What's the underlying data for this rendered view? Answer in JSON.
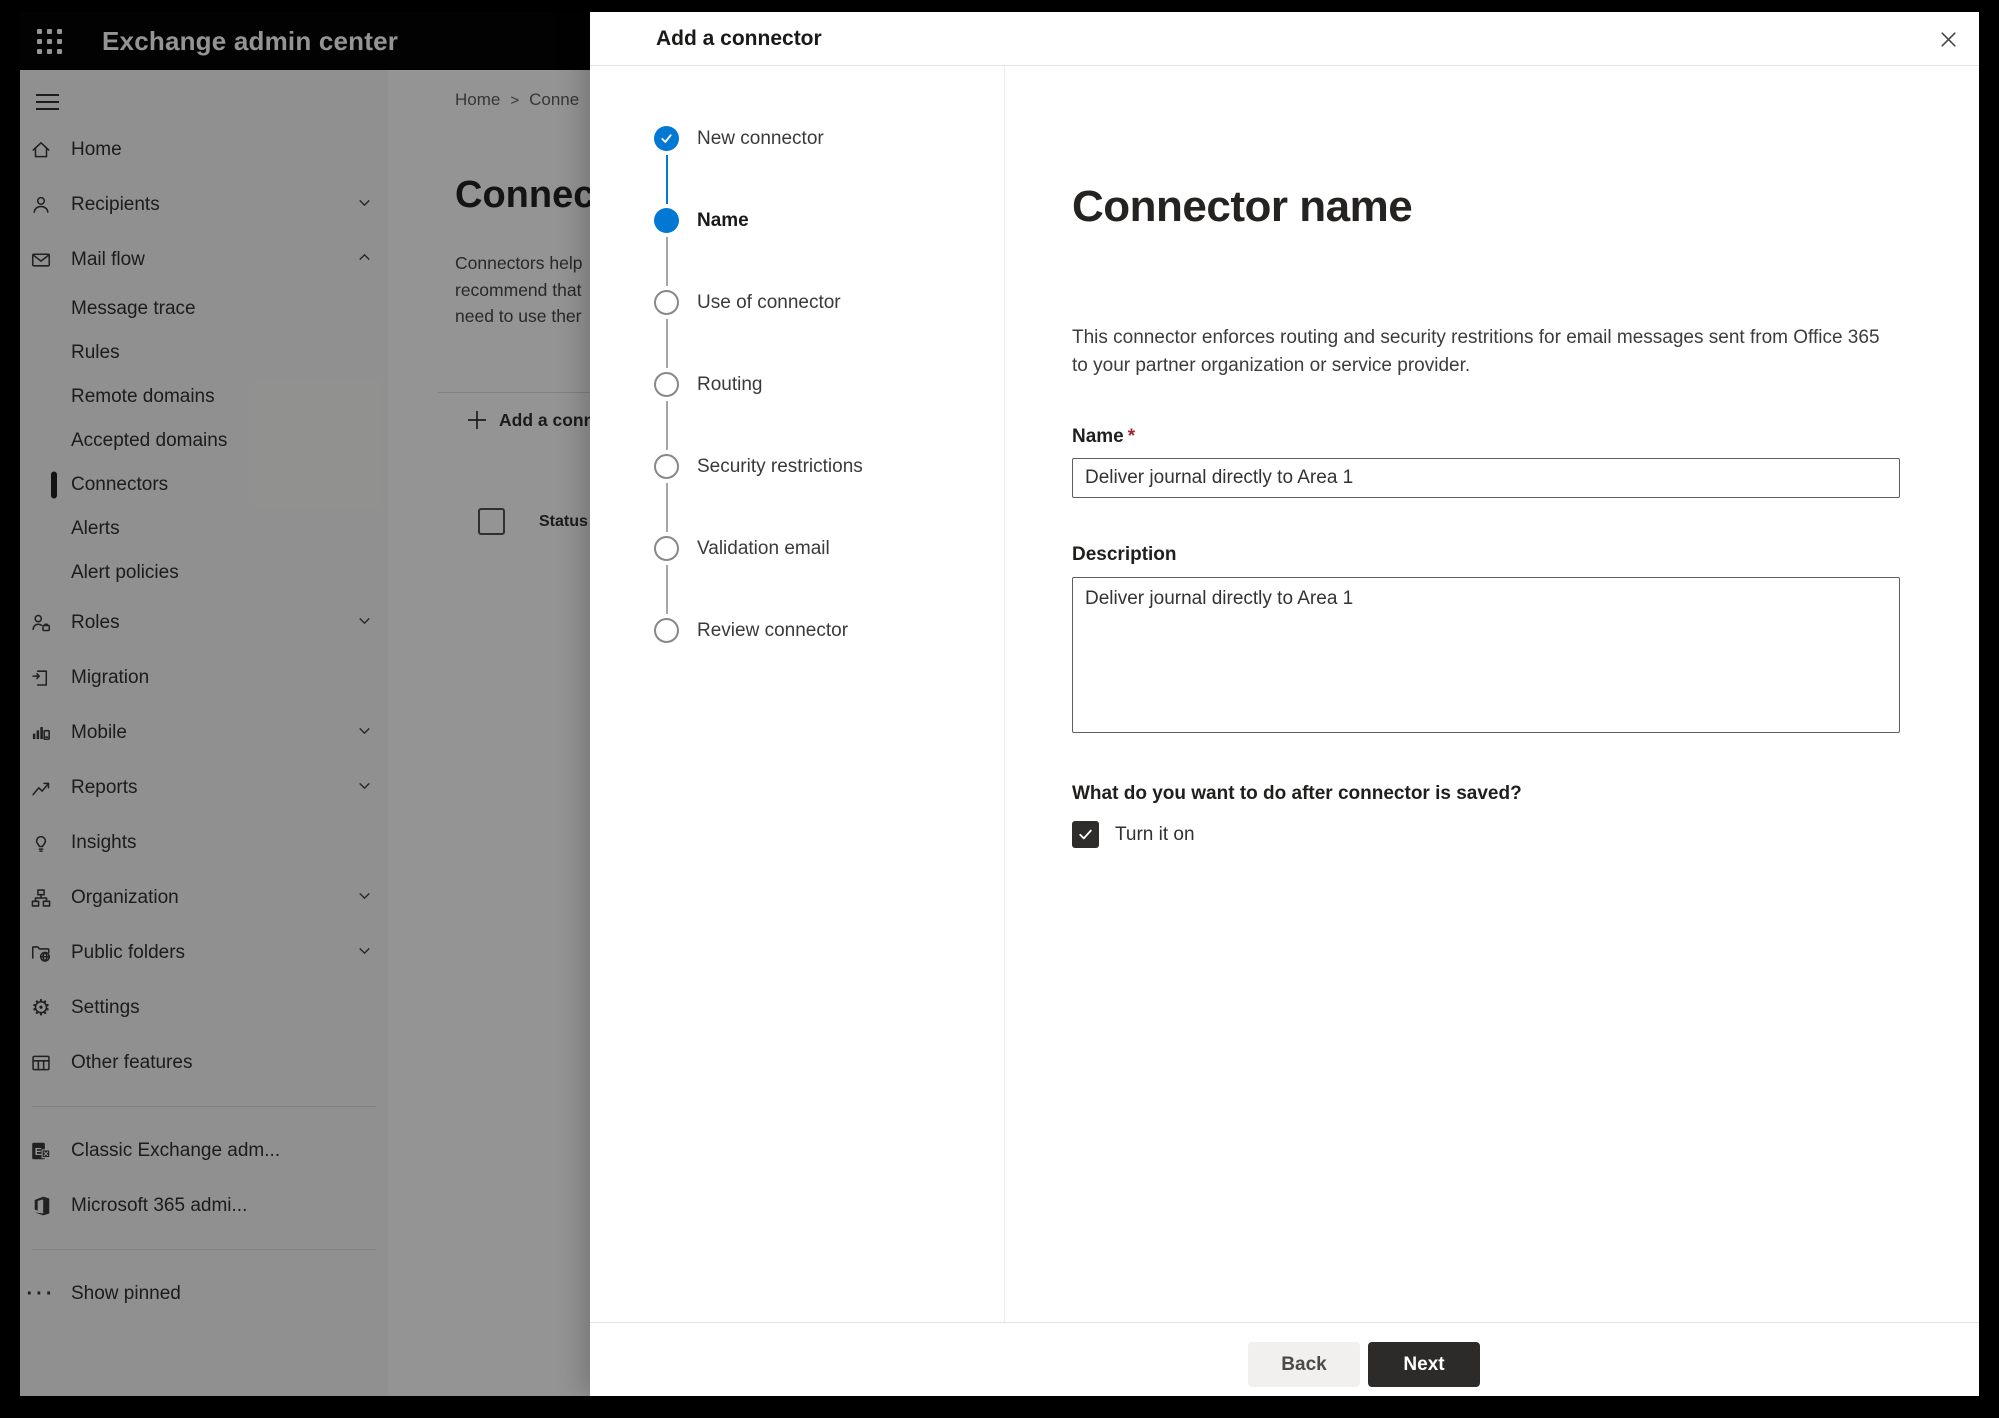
{
  "app": {
    "title": "Exchange admin center"
  },
  "sidebar": {
    "items": [
      {
        "label": "Home",
        "icon": "home-icon"
      },
      {
        "label": "Recipients",
        "icon": "person-icon",
        "chevron": "down"
      },
      {
        "label": "Mail flow",
        "icon": "mail-icon",
        "chevron": "up"
      },
      {
        "label": "Message trace",
        "sub": true
      },
      {
        "label": "Rules",
        "sub": true
      },
      {
        "label": "Remote domains",
        "sub": true
      },
      {
        "label": "Accepted domains",
        "sub": true
      },
      {
        "label": "Connectors",
        "sub": true,
        "selected": true
      },
      {
        "label": "Alerts",
        "sub": true
      },
      {
        "label": "Alert policies",
        "sub": true
      },
      {
        "label": "Roles",
        "icon": "roles-icon",
        "chevron": "down"
      },
      {
        "label": "Migration",
        "icon": "migration-icon"
      },
      {
        "label": "Mobile",
        "icon": "mobile-icon",
        "chevron": "down"
      },
      {
        "label": "Reports",
        "icon": "reports-icon",
        "chevron": "down"
      },
      {
        "label": "Insights",
        "icon": "insights-icon"
      },
      {
        "label": "Organization",
        "icon": "organization-icon",
        "chevron": "down"
      },
      {
        "label": "Public folders",
        "icon": "public-folders-icon",
        "chevron": "down"
      },
      {
        "label": "Settings",
        "icon": "settings-icon"
      },
      {
        "label": "Other features",
        "icon": "other-features-icon"
      },
      {
        "divider": true
      },
      {
        "label": "Classic Exchange adm...",
        "icon": "classic-exchange-icon"
      },
      {
        "label": "Microsoft 365 admi...",
        "icon": "microsoft-365-icon"
      },
      {
        "divider": true
      },
      {
        "label": "Show pinned",
        "icon": "ellipsis-icon"
      }
    ]
  },
  "background": {
    "breadcrumb": {
      "home": "Home",
      "separator": ">",
      "current": "Conne"
    },
    "page_title": "Connec",
    "description_lines": "Connectors help\nrecommend that\nneed to use ther",
    "add_button_label": "Add a conn",
    "table": {
      "status_header": "Status"
    }
  },
  "panel": {
    "title": "Add a connector",
    "steps": [
      {
        "label": "New connector",
        "state": "completed",
        "line": "accent"
      },
      {
        "label": "Name",
        "state": "current",
        "line": "gray"
      },
      {
        "label": "Use of connector",
        "state": "upcoming",
        "line": "gray"
      },
      {
        "label": "Routing",
        "state": "upcoming",
        "line": "gray"
      },
      {
        "label": "Security restrictions",
        "state": "upcoming",
        "line": "gray"
      },
      {
        "label": "Validation email",
        "state": "upcoming",
        "line": "gray"
      },
      {
        "label": "Review connector",
        "state": "upcoming",
        "line": "none"
      }
    ],
    "content": {
      "title": "Connector name",
      "description": "This connector enforces routing and security restritions for email messages sent from Office 365 to your partner organization or service provider.",
      "name_label": "Name",
      "required_marker": "*",
      "name_value": "Deliver journal directly to Area 1",
      "description_label": "Description",
      "description_value": "Deliver journal directly to Area 1",
      "after_save_question": "What do you want to do after connector is saved?",
      "turn_on_label": "Turn it on",
      "turn_on_checked": true
    },
    "footer": {
      "back_label": "Back",
      "next_label": "Next"
    }
  },
  "colors": {
    "accent_blue": "#0078d4",
    "header_bg": "#050505",
    "primary_button_bg": "#2c2b2a",
    "secondary_button_bg": "#f1f0ee",
    "required_red": "#a4262c"
  }
}
